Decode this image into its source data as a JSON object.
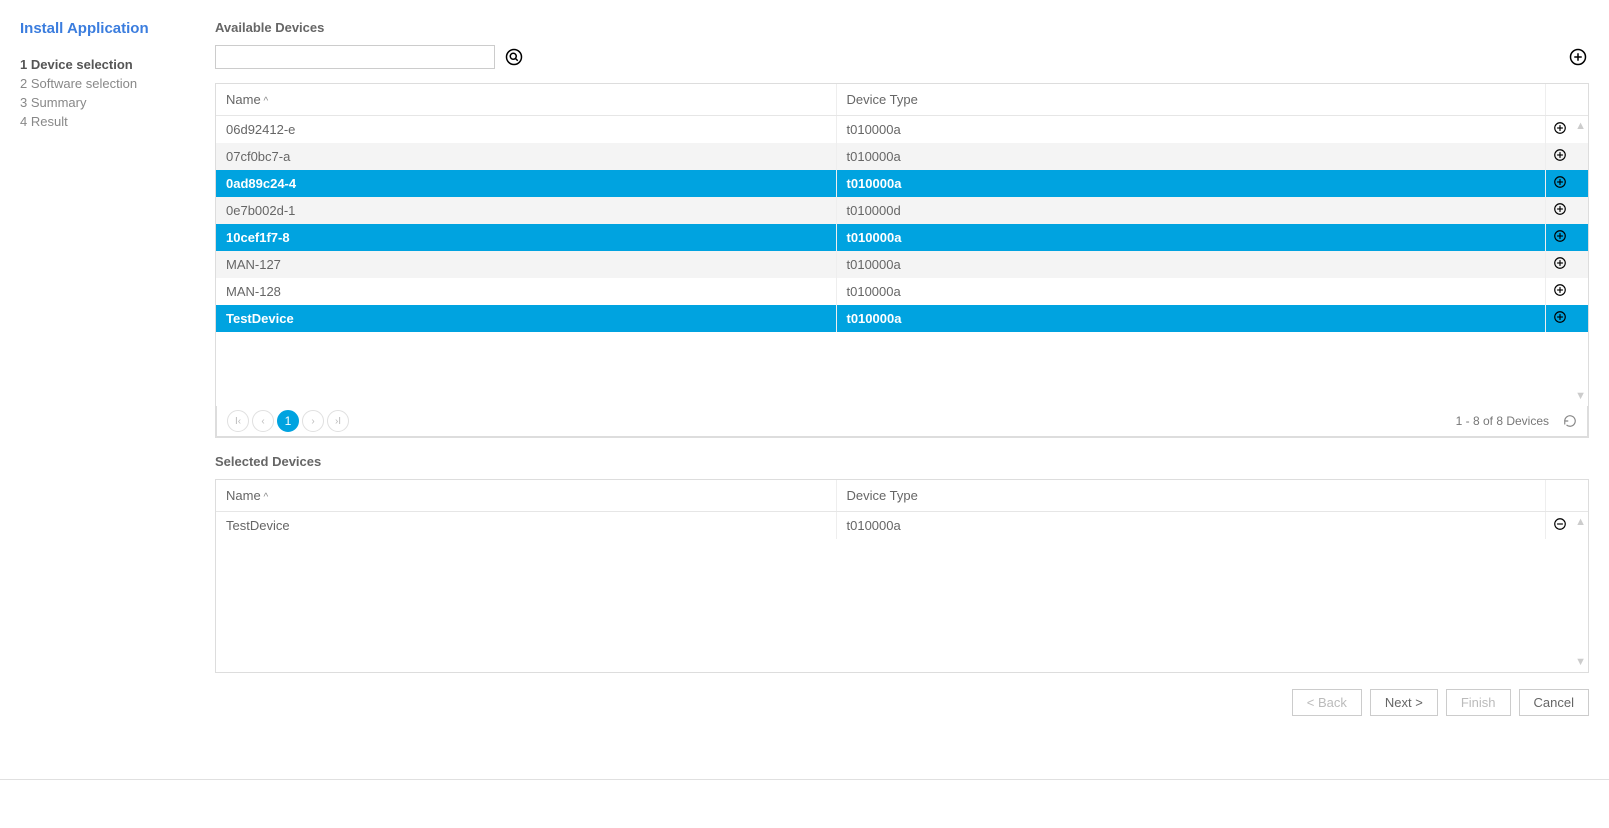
{
  "wizard": {
    "title": "Install Application",
    "steps": [
      "1 Device selection",
      "2 Software selection",
      "3 Summary",
      "4 Result"
    ],
    "activeStep": 0
  },
  "available": {
    "section_title": "Available Devices",
    "search_placeholder": "",
    "columns": {
      "name": "Name",
      "type": "Device Type"
    },
    "rows": [
      {
        "name": "06d92412-e",
        "type": "t010000a",
        "selected": false
      },
      {
        "name": "07cf0bc7-a",
        "type": "t010000a",
        "selected": false
      },
      {
        "name": "0ad89c24-4",
        "type": "t010000a",
        "selected": true
      },
      {
        "name": "0e7b002d-1",
        "type": "t010000d",
        "selected": false
      },
      {
        "name": "10cef1f7-8",
        "type": "t010000a",
        "selected": true
      },
      {
        "name": "MAN-127",
        "type": "t010000a",
        "selected": false
      },
      {
        "name": "MAN-128",
        "type": "t010000a",
        "selected": false
      },
      {
        "name": "TestDevice",
        "type": "t010000a",
        "selected": true
      }
    ],
    "pager": {
      "current": "1",
      "summary": "1 - 8 of 8 Devices"
    }
  },
  "selected": {
    "section_title": "Selected Devices",
    "columns": {
      "name": "Name",
      "type": "Device Type"
    },
    "rows": [
      {
        "name": "TestDevice",
        "type": "t010000a"
      }
    ]
  },
  "footer": {
    "back": "< Back",
    "next": "Next >",
    "finish": "Finish",
    "cancel": "Cancel"
  }
}
